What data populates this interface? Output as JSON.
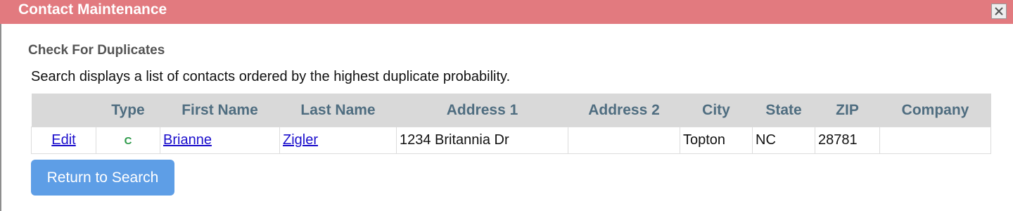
{
  "window": {
    "title": "Contact Maintenance",
    "close_icon": "close-icon"
  },
  "section": {
    "title": "Check For Duplicates",
    "description": "Search displays a list of contacts ordered by the highest duplicate probability."
  },
  "table": {
    "headers": [
      "",
      "Type",
      "First Name",
      "Last Name",
      "Address 1",
      "Address 2",
      "City",
      "State",
      "ZIP",
      "Company"
    ],
    "rows": [
      {
        "action": "Edit",
        "type": "C",
        "first_name": "Brianne",
        "last_name": "Zigler",
        "address1": "1234 Britannia Dr",
        "address2": "",
        "city": "Topton",
        "state": "NC",
        "zip": "28781",
        "company": ""
      }
    ]
  },
  "buttons": {
    "return": "Return to Search"
  },
  "colors": {
    "titlebar": "#e27a7f",
    "header_bg": "#d9d9d9",
    "header_text": "#4f6d80",
    "link": "#1a0dcc",
    "type_badge": "#2e9a4a",
    "button": "#5e9ee6"
  }
}
